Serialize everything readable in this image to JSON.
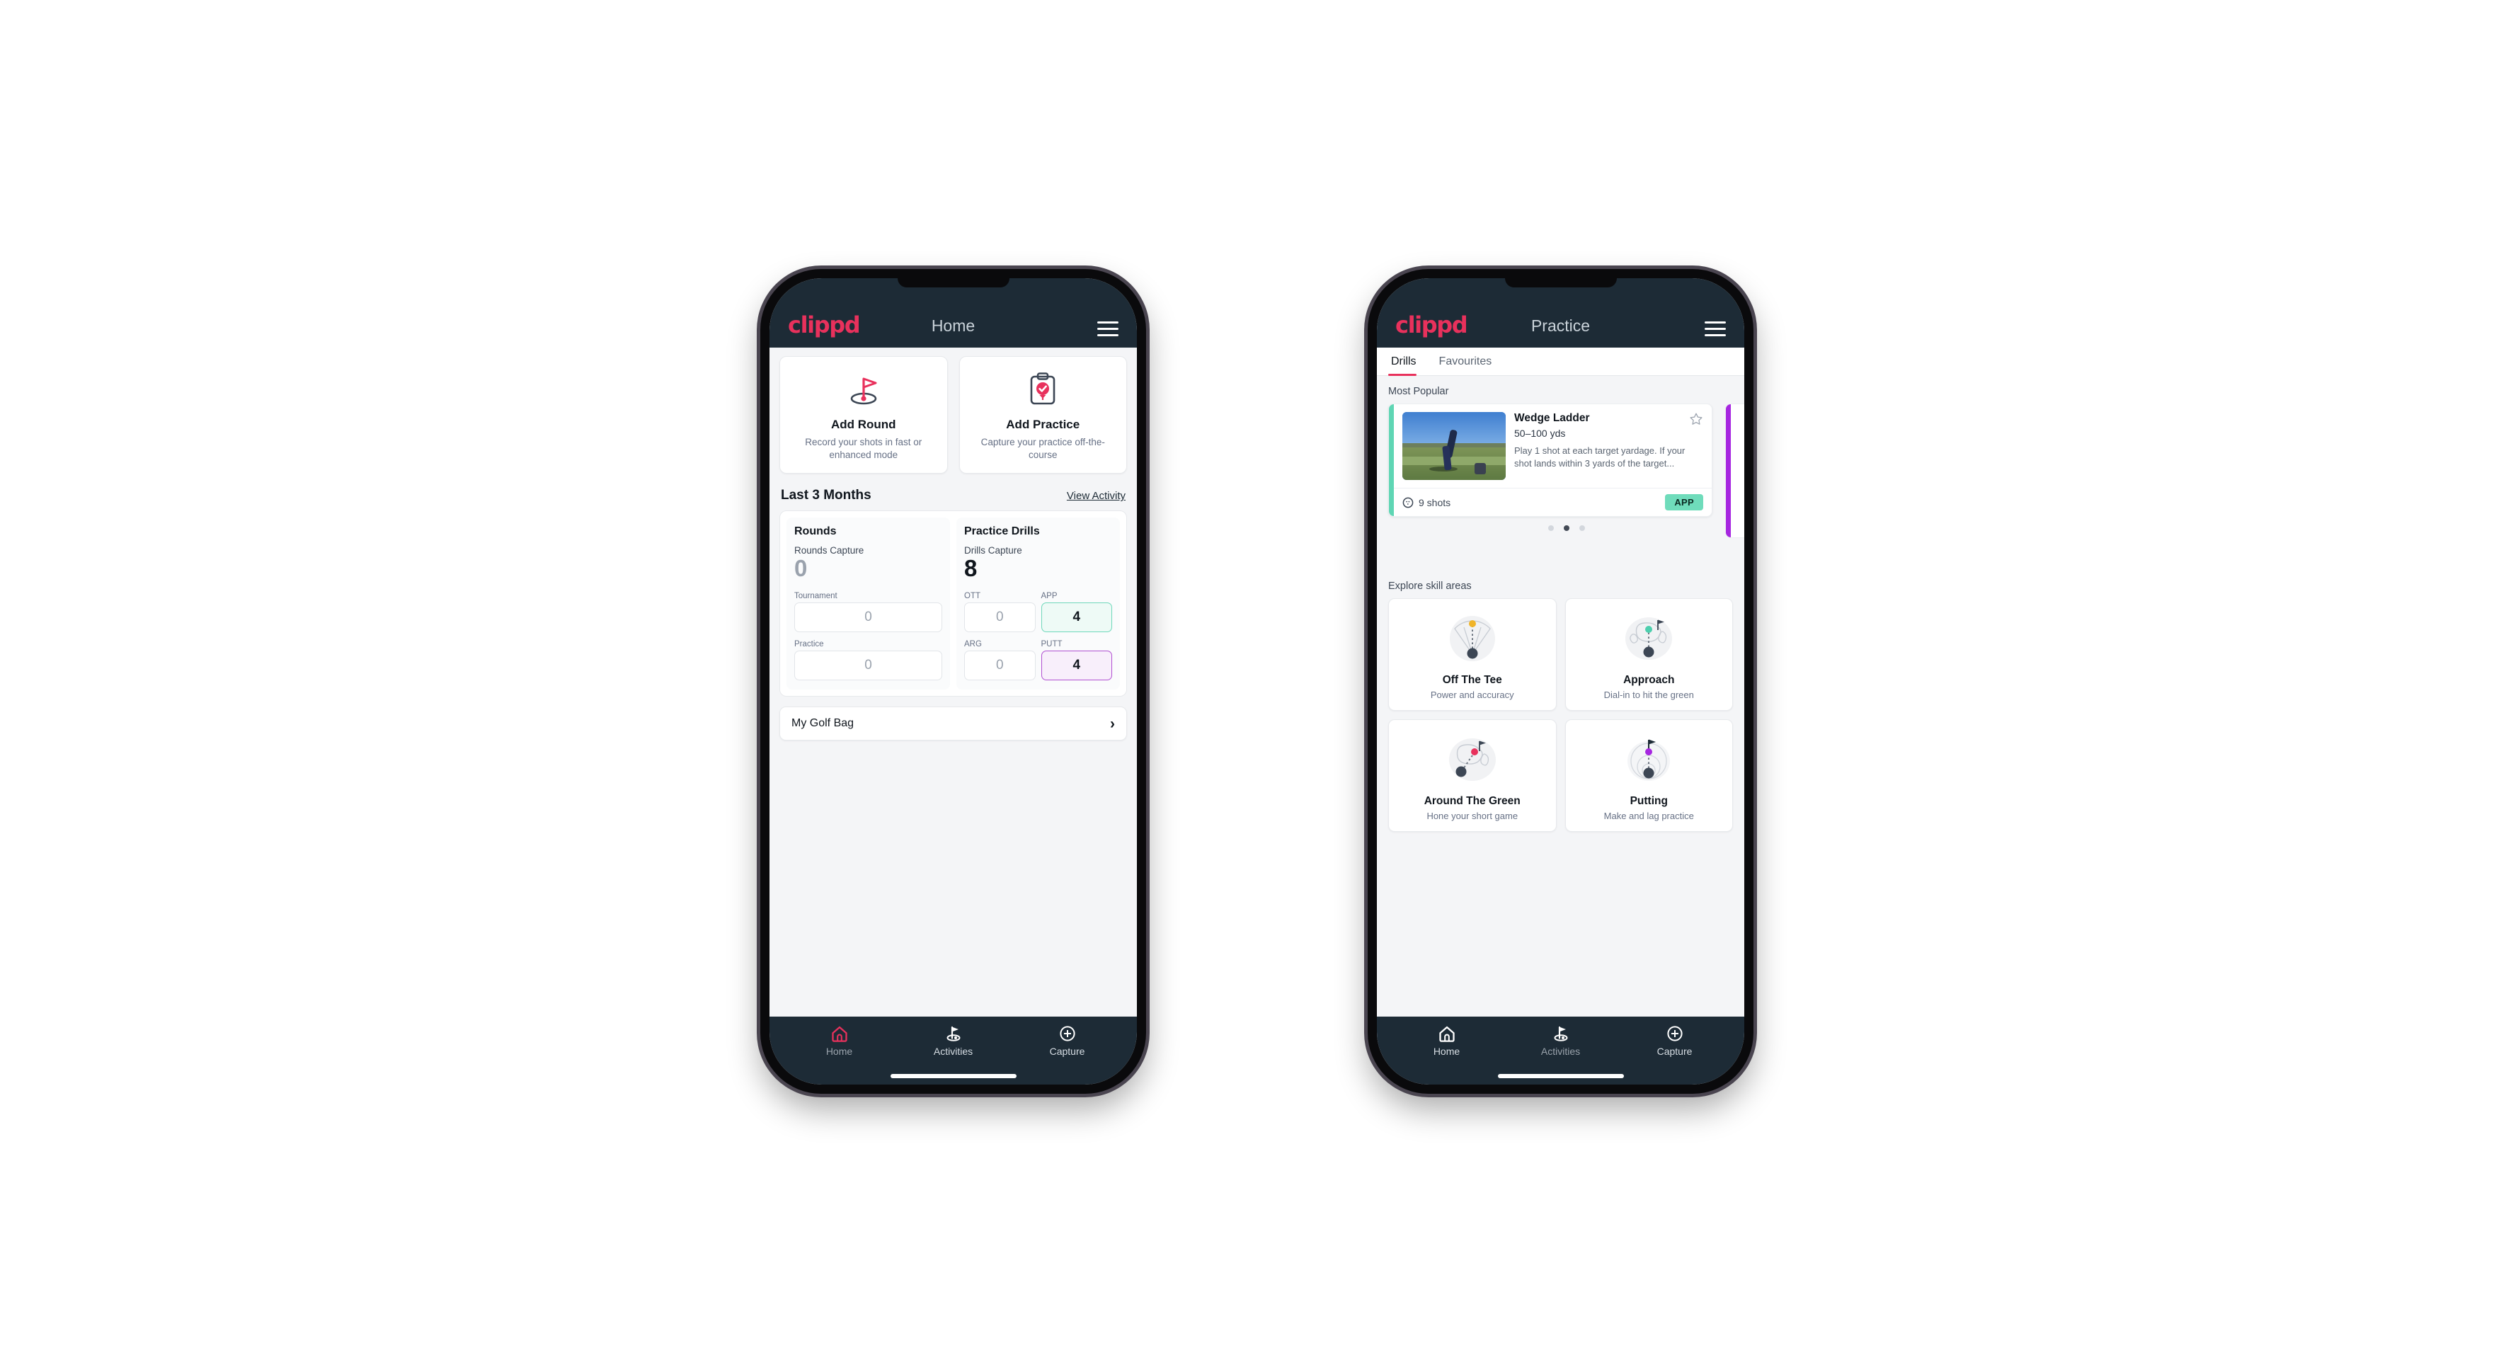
{
  "brand": {
    "logo_text": "clippd",
    "accent_pink": "#e8315c",
    "dark_navy": "#1d2b36",
    "teal": "#6fdcbb",
    "purple": "#a626e0"
  },
  "phone_home": {
    "appbar": {
      "title": "Home",
      "logo": "clippd",
      "menu_icon": "hamburger-icon"
    },
    "quick_actions": [
      {
        "icon": "golf-flag-hole-icon",
        "title": "Add Round",
        "subtitle": "Record your shots in fast or enhanced mode"
      },
      {
        "icon": "clipboard-check-icon",
        "title": "Add Practice",
        "subtitle": "Capture your practice off-the-course"
      }
    ],
    "section": {
      "title": "Last 3 Months",
      "link": "View Activity"
    },
    "stats": {
      "rounds": {
        "heading": "Rounds",
        "capture_label": "Rounds Capture",
        "capture_value": "0",
        "items": [
          {
            "label": "Tournament",
            "value": "0",
            "state": "empty"
          },
          {
            "label": "Practice",
            "value": "0",
            "state": "empty"
          }
        ]
      },
      "practice_drills": {
        "heading": "Practice Drills",
        "capture_label": "Drills Capture",
        "capture_value": "8",
        "items": [
          {
            "label": "OTT",
            "value": "0",
            "state": "empty"
          },
          {
            "label": "APP",
            "value": "4",
            "state": "app"
          },
          {
            "label": "ARG",
            "value": "0",
            "state": "empty"
          },
          {
            "label": "PUTT",
            "value": "4",
            "state": "putt"
          }
        ]
      }
    },
    "golf_bag": {
      "label": "My Golf Bag",
      "chevron": "chevron-right-icon"
    },
    "bottom_nav": [
      {
        "icon": "home-icon",
        "label": "Home",
        "active": true
      },
      {
        "icon": "golf-flag-icon",
        "label": "Activities",
        "active": false
      },
      {
        "icon": "plus-circle-icon",
        "label": "Capture",
        "active": false
      }
    ]
  },
  "phone_practice": {
    "appbar": {
      "title": "Practice",
      "logo": "clippd",
      "menu_icon": "hamburger-icon"
    },
    "tabs": [
      {
        "label": "Drills",
        "active": true
      },
      {
        "label": "Favourites",
        "active": false
      }
    ],
    "most_popular_label": "Most Popular",
    "drill": {
      "title": "Wedge Ladder",
      "yardage": "50–100 yds",
      "description": "Play 1 shot at each target yardage. If your shot lands within 3 yards of the target...",
      "shots": "9 shots",
      "shots_icon": "golf-ball-icon",
      "badge": "APP",
      "favourite_icon": "star-outline-icon",
      "accent_color": "#5fd6b4",
      "thumbnail": "golfer-wedge-shot-photo"
    },
    "carousel_dots": {
      "count": 3,
      "active_index": 1
    },
    "explore_label": "Explore skill areas",
    "skill_areas": [
      {
        "icon": "tee-shot-fan-icon",
        "title": "Off The Tee",
        "subtitle": "Power and accuracy"
      },
      {
        "icon": "approach-green-icon",
        "title": "Approach",
        "subtitle": "Dial-in to hit the green"
      },
      {
        "icon": "chip-around-green-icon",
        "title": "Around The Green",
        "subtitle": "Hone your short game"
      },
      {
        "icon": "putting-rings-icon",
        "title": "Putting",
        "subtitle": "Make and lag practice"
      }
    ],
    "bottom_nav": [
      {
        "icon": "home-icon",
        "label": "Home",
        "active": false
      },
      {
        "icon": "golf-flag-icon",
        "label": "Activities",
        "active": true
      },
      {
        "icon": "plus-circle-icon",
        "label": "Capture",
        "active": false
      }
    ]
  }
}
